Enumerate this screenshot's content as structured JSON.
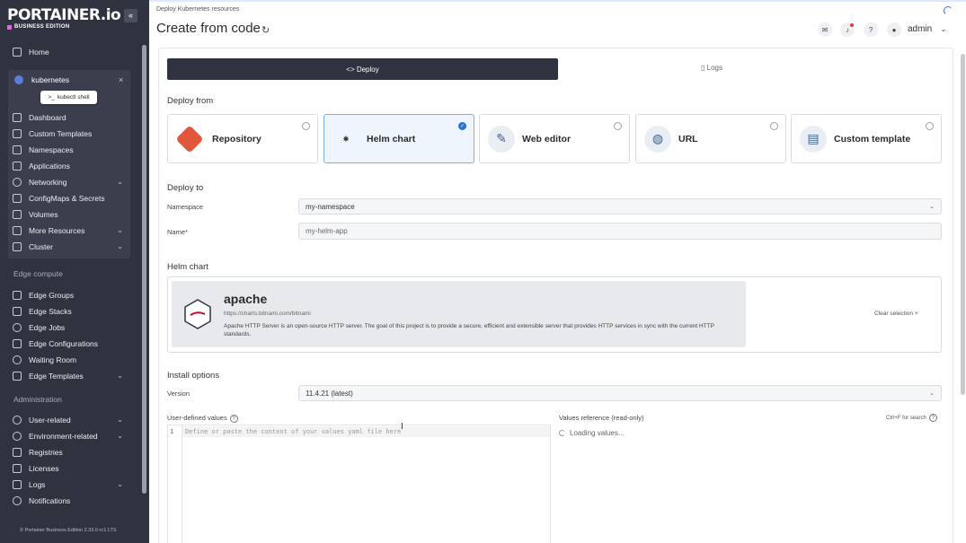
{
  "sidebar": {
    "logo": "PORTAINER.io",
    "logo_sub": "BUSINESS EDITION",
    "collapse": "«",
    "home": "Home",
    "environment": {
      "name": "kubernetes",
      "close": "×",
      "kubectl": "kubectl shell",
      "items": [
        {
          "label": "Dashboard"
        },
        {
          "label": "Custom Templates"
        },
        {
          "label": "Namespaces"
        },
        {
          "label": "Applications"
        },
        {
          "label": "Networking"
        },
        {
          "label": "ConfigMaps & Secrets"
        },
        {
          "label": "Volumes"
        },
        {
          "label": "More Resources"
        },
        {
          "label": "Cluster"
        }
      ]
    },
    "edge_title": "Edge compute",
    "edge_items": [
      {
        "label": "Edge Groups"
      },
      {
        "label": "Edge Stacks"
      },
      {
        "label": "Edge Jobs"
      },
      {
        "label": "Edge Configurations"
      },
      {
        "label": "Waiting Room"
      },
      {
        "label": "Edge Templates"
      }
    ],
    "admin_title": "Administration",
    "admin_items": [
      {
        "label": "User-related"
      },
      {
        "label": "Environment-related"
      },
      {
        "label": "Registries"
      },
      {
        "label": "Licenses"
      },
      {
        "label": "Logs"
      },
      {
        "label": "Notifications"
      }
    ],
    "footer": "© Portainer Business Edition 2.33.0-rc1 LTS"
  },
  "header": {
    "breadcrumb": "Deploy Kubernetes resources",
    "title": "Create from code",
    "user": "admin"
  },
  "tabs": {
    "deploy": "<> Deploy",
    "logs": "Logs"
  },
  "deploy_from": {
    "title": "Deploy from",
    "options": [
      {
        "label": "Repository",
        "selected": false
      },
      {
        "label": "Helm chart",
        "selected": true
      },
      {
        "label": "Web editor",
        "selected": false
      },
      {
        "label": "URL",
        "selected": false
      },
      {
        "label": "Custom template",
        "selected": false
      }
    ]
  },
  "deploy_to": {
    "title": "Deploy to",
    "namespace_label": "Namespace",
    "namespace_value": "my-namespace",
    "name_label": "Name*",
    "name_placeholder": "my-helm-app"
  },
  "helm_chart": {
    "title": "Helm chart",
    "name": "apache",
    "url": "https://charts.bitnami.com/bitnami",
    "description": "Apache HTTP Server is an open-source HTTP server. The goal of this project is to provide a secure, efficient and extensible server that provides HTTP services in sync with the current HTTP standards.",
    "clear": "Clear selection ×"
  },
  "install": {
    "title": "Install options",
    "version_label": "Version",
    "version_value": "11.4.21 (latest)",
    "values_label": "User-defined values",
    "editor_line": "1",
    "editor_placeholder": "Define or paste the content of your values yaml file here",
    "ref_label": "Values reference (read-only)",
    "ctrl_search": "Ctrl+F for search",
    "loading": "Loading values..."
  },
  "colors": {
    "sidebar_bg": "#2f3340",
    "accent": "#2d6fd2",
    "deploy_tab": "#2f3340"
  }
}
